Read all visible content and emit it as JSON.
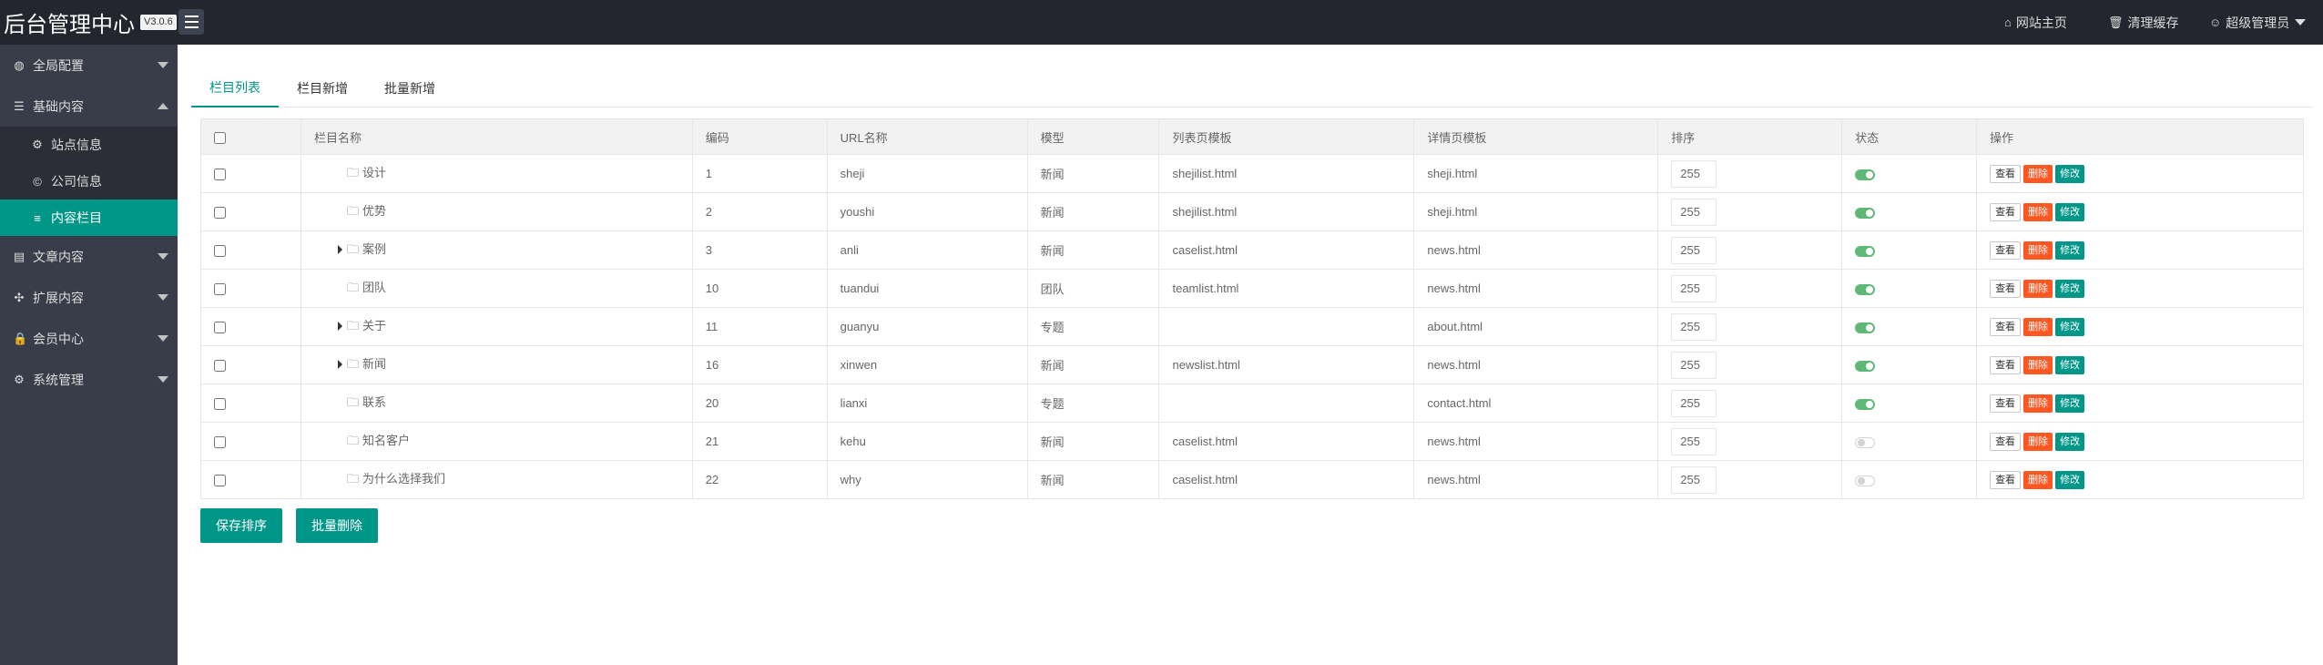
{
  "app": {
    "title": "后台管理中心",
    "version": "V3.0.6"
  },
  "header": {
    "home": "网站主页",
    "cache": "清理缓存",
    "user": "超级管理员"
  },
  "sidebar": {
    "items": [
      {
        "label": "全局配置",
        "icon": "globe-icon"
      },
      {
        "label": "基础内容",
        "icon": "sliders-icon",
        "expanded": true,
        "children": [
          {
            "label": "站点信息",
            "icon": "gear-icon"
          },
          {
            "label": "公司信息",
            "icon": "copyright-icon"
          },
          {
            "label": "内容栏目",
            "icon": "bars-icon",
            "active": true
          }
        ]
      },
      {
        "label": "文章内容",
        "icon": "file-icon"
      },
      {
        "label": "扩展内容",
        "icon": "expand-icon"
      },
      {
        "label": "会员中心",
        "icon": "lock-icon"
      },
      {
        "label": "系统管理",
        "icon": "gear-icon"
      }
    ]
  },
  "tabs": [
    "栏目列表",
    "栏目新增",
    "批量新增"
  ],
  "table": {
    "headers": [
      "",
      "栏目名称",
      "编码",
      "URL名称",
      "模型",
      "列表页模板",
      "详情页模板",
      "排序",
      "状态",
      "操作"
    ],
    "rows": [
      {
        "name": "设计",
        "code": "1",
        "url": "sheji",
        "model": "新闻",
        "list_tpl": "shejilist.html",
        "detail_tpl": "sheji.html",
        "sort": "255",
        "status": true,
        "has_children": false
      },
      {
        "name": "优势",
        "code": "2",
        "url": "youshi",
        "model": "新闻",
        "list_tpl": "shejilist.html",
        "detail_tpl": "sheji.html",
        "sort": "255",
        "status": true,
        "has_children": false
      },
      {
        "name": "案例",
        "code": "3",
        "url": "anli",
        "model": "新闻",
        "list_tpl": "caselist.html",
        "detail_tpl": "news.html",
        "sort": "255",
        "status": true,
        "has_children": true
      },
      {
        "name": "团队",
        "code": "10",
        "url": "tuandui",
        "model": "团队",
        "list_tpl": "teamlist.html",
        "detail_tpl": "news.html",
        "sort": "255",
        "status": true,
        "has_children": false
      },
      {
        "name": "关于",
        "code": "11",
        "url": "guanyu",
        "model": "专题",
        "list_tpl": "",
        "detail_tpl": "about.html",
        "sort": "255",
        "status": true,
        "has_children": true
      },
      {
        "name": "新闻",
        "code": "16",
        "url": "xinwen",
        "model": "新闻",
        "list_tpl": "newslist.html",
        "detail_tpl": "news.html",
        "sort": "255",
        "status": true,
        "has_children": true
      },
      {
        "name": "联系",
        "code": "20",
        "url": "lianxi",
        "model": "专题",
        "list_tpl": "",
        "detail_tpl": "contact.html",
        "sort": "255",
        "status": true,
        "has_children": false
      },
      {
        "name": "知名客户",
        "code": "21",
        "url": "kehu",
        "model": "新闻",
        "list_tpl": "caselist.html",
        "detail_tpl": "news.html",
        "sort": "255",
        "status": false,
        "has_children": false
      },
      {
        "name": "为什么选择我们",
        "code": "22",
        "url": "why",
        "model": "新闻",
        "list_tpl": "caselist.html",
        "detail_tpl": "news.html",
        "sort": "255",
        "status": false,
        "has_children": false
      }
    ],
    "row_actions": {
      "view": "查看",
      "delete": "删除",
      "edit": "修改"
    }
  },
  "buttons": {
    "save_sort": "保存排序",
    "batch_delete": "批量删除"
  },
  "colors": {
    "accent": "#009688",
    "danger": "#ff5722",
    "switch_on": "#5fb878",
    "sidebar": "#393d49",
    "header": "#23262e"
  }
}
